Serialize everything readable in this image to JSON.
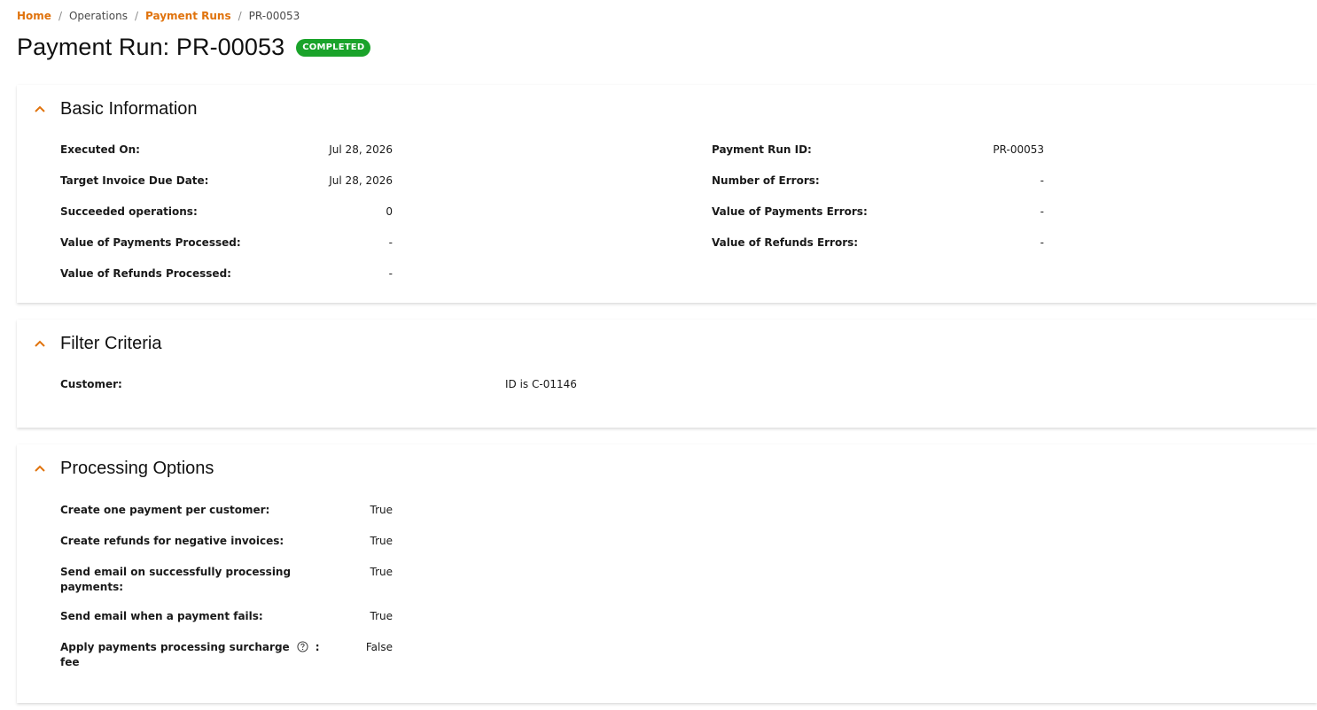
{
  "breadcrumb": {
    "home": "Home",
    "operations": "Operations",
    "payment_runs": "Payment Runs",
    "current": "PR-00053",
    "separator": "/"
  },
  "page": {
    "title": "Payment Run: PR-00053",
    "status": "COMPLETED",
    "status_color": "#1aa32a",
    "accent_color": "#e0730d"
  },
  "basic_info": {
    "title": "Basic Information",
    "left": [
      {
        "label": "Executed On:",
        "value": "Jul 28, 2026"
      },
      {
        "label": "Target Invoice Due Date:",
        "value": "Jul 28, 2026"
      },
      {
        "label": "Succeeded operations:",
        "value": "0"
      },
      {
        "label": "Value of Payments Processed:",
        "value": "-"
      },
      {
        "label": "Value of Refunds Processed:",
        "value": "-"
      }
    ],
    "right": [
      {
        "label": "Payment Run ID:",
        "value": "PR-00053"
      },
      {
        "label": "Number of Errors:",
        "value": "-"
      },
      {
        "label": "Value of Payments Errors:",
        "value": "-"
      },
      {
        "label": "Value of Refunds Errors:",
        "value": "-"
      }
    ]
  },
  "filter_criteria": {
    "title": "Filter Criteria",
    "items": [
      {
        "label": "Customer:",
        "value": "ID is C-01146"
      }
    ]
  },
  "processing_options": {
    "title": "Processing Options",
    "items": [
      {
        "label": "Create one payment per customer:",
        "value": "True"
      },
      {
        "label": "Create refunds for negative invoices:",
        "value": "True"
      },
      {
        "label_line1": "Send email on successfully processing",
        "label_line2": "payments:",
        "value": "True"
      },
      {
        "label": "Send email when a payment fails:",
        "value": "True"
      },
      {
        "label_line1": "Apply payments processing surcharge",
        "label_suffix": ":",
        "label_line2": "fee",
        "value": "False"
      }
    ]
  },
  "icons": {
    "chevron": "chevron-up-icon",
    "help": "help-circle-icon"
  }
}
